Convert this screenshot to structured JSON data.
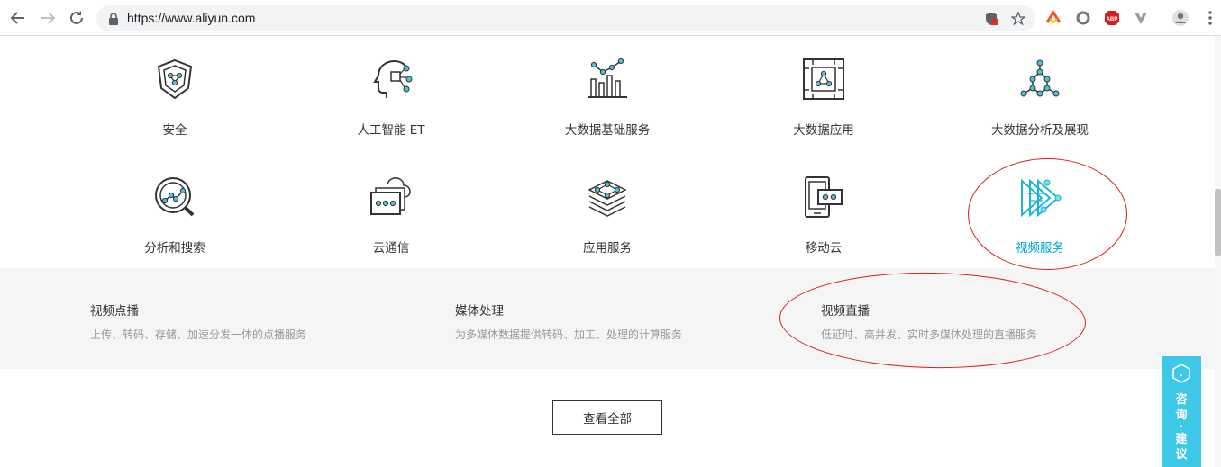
{
  "browser": {
    "url": "https://www.aliyun.com"
  },
  "products": [
    {
      "label": "安全"
    },
    {
      "label": "人工智能 ET"
    },
    {
      "label": "大数据基础服务"
    },
    {
      "label": "大数据应用"
    },
    {
      "label": "大数据分析及展现"
    },
    {
      "label": "分析和搜索"
    },
    {
      "label": "云通信"
    },
    {
      "label": "应用服务"
    },
    {
      "label": "移动云"
    },
    {
      "label": "视频服务"
    }
  ],
  "video_sub": [
    {
      "title": "视频点播",
      "desc": "上传、转码、存储、加速分发一体的点播服务"
    },
    {
      "title": "媒体处理",
      "desc": "为多媒体数据提供转码、加工、处理的计算服务"
    },
    {
      "title": "视频直播",
      "desc": "低延时、高并发、实时多媒体处理的直播服务"
    }
  ],
  "view_all": "查看全部",
  "consult": {
    "line1": "咨",
    "line2": "询",
    "sep": "·",
    "line3": "建",
    "line4": "议"
  },
  "colors": {
    "accent": "#00a6d6",
    "consult_bg": "#3cc8e6",
    "annotation": "#d81e1e"
  }
}
